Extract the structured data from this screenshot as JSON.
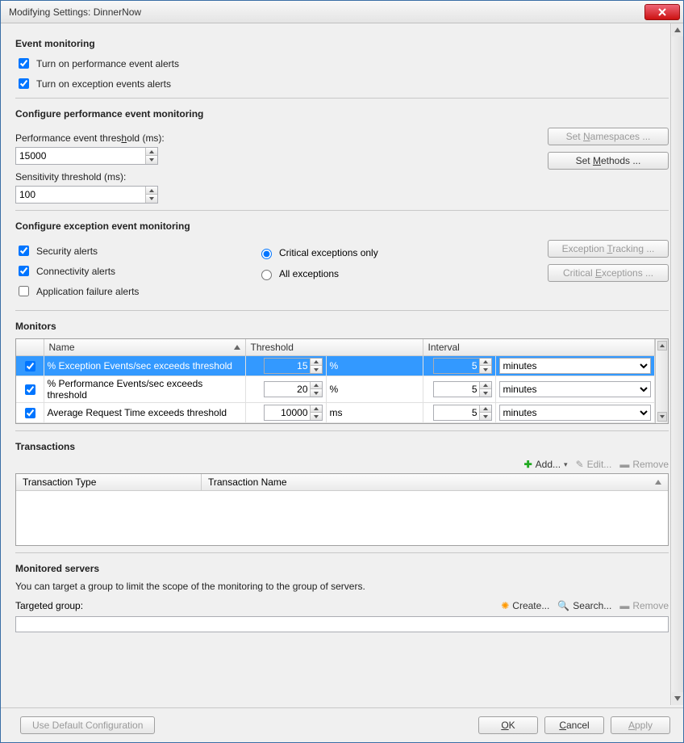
{
  "window": {
    "title": "Modifying Settings: DinnerNow"
  },
  "event_monitoring": {
    "heading": "Event monitoring",
    "perf_alerts_label": "Turn on performance event alerts",
    "perf_alerts_checked": true,
    "exc_alerts_label": "Turn on exception events alerts",
    "exc_alerts_checked": true
  },
  "perf_config": {
    "heading": "Configure performance event monitoring",
    "threshold_label": "Performance event threshold (ms):",
    "threshold_value": "15000",
    "sensitivity_label": "Sensitivity threshold (ms):",
    "sensitivity_value": "100",
    "set_namespaces_btn": "Set Namespaces ...",
    "set_methods_btn": "Set Methods ..."
  },
  "exc_config": {
    "heading": "Configure exception event monitoring",
    "security_label": "Security alerts",
    "security_checked": true,
    "connectivity_label": "Connectivity alerts",
    "connectivity_checked": true,
    "appfail_label": "Application failure alerts",
    "appfail_checked": false,
    "radio_critical": "Critical exceptions only",
    "radio_all": "All exceptions",
    "radio_selected": "critical",
    "exception_tracking_btn": "Exception Tracking ...",
    "critical_exceptions_btn": "Critical Exceptions ..."
  },
  "monitors": {
    "heading": "Monitors",
    "columns": {
      "name": "Name",
      "threshold": "Threshold",
      "interval": "Interval"
    },
    "rows": [
      {
        "checked": true,
        "name": "% Exception Events/sec exceeds threshold",
        "threshold": "15",
        "unit1": "%",
        "interval": "5",
        "unit2": "minutes",
        "selected": true
      },
      {
        "checked": true,
        "name": "% Performance Events/sec exceeds threshold",
        "threshold": "20",
        "unit1": "%",
        "interval": "5",
        "unit2": "minutes",
        "selected": false
      },
      {
        "checked": true,
        "name": "Average Request Time exceeds threshold",
        "threshold": "10000",
        "unit1": "ms",
        "interval": "5",
        "unit2": "minutes",
        "selected": false
      }
    ]
  },
  "transactions": {
    "heading": "Transactions",
    "add_btn": "Add...",
    "edit_btn": "Edit...",
    "remove_btn": "Remove",
    "col_type": "Transaction Type",
    "col_name": "Transaction Name"
  },
  "monitored_servers": {
    "heading": "Monitored servers",
    "description": "You can target a group to limit the scope of the monitoring to the group of servers.",
    "targeted_label": "Targeted group:",
    "create_btn": "Create...",
    "search_btn": "Search...",
    "remove_btn": "Remove"
  },
  "footer": {
    "use_default_btn": "Use Default Configuration",
    "ok_btn": "OK",
    "cancel_btn": "Cancel",
    "apply_btn": "Apply"
  }
}
